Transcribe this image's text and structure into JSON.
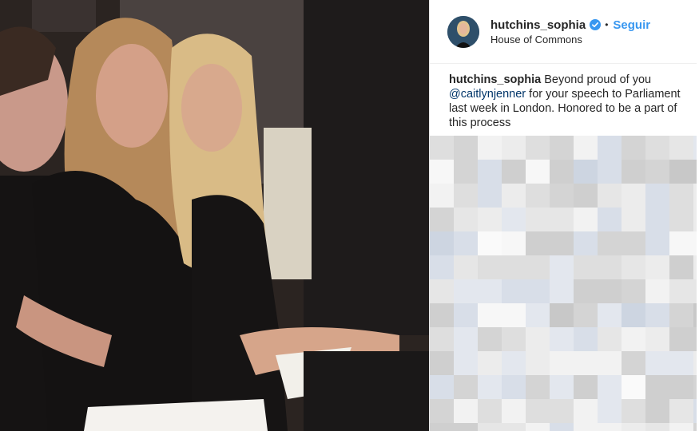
{
  "post": {
    "username": "hutchins_sophia",
    "follow_label": "Seguir",
    "separator": "•",
    "location": "House of Commons",
    "caption": {
      "username": "hutchins_sophia",
      "text_before": " Beyond proud of you ",
      "mention": "@caitlynjenner",
      "text_after": " for your speech to Parliament last week in London. Honored to be a part of this process"
    }
  },
  "icons": {
    "verified": "verified-badge-icon"
  },
  "colors": {
    "follow": "#3897f0",
    "verified": "#3897f0",
    "text": "#262626",
    "mention": "#003569"
  }
}
